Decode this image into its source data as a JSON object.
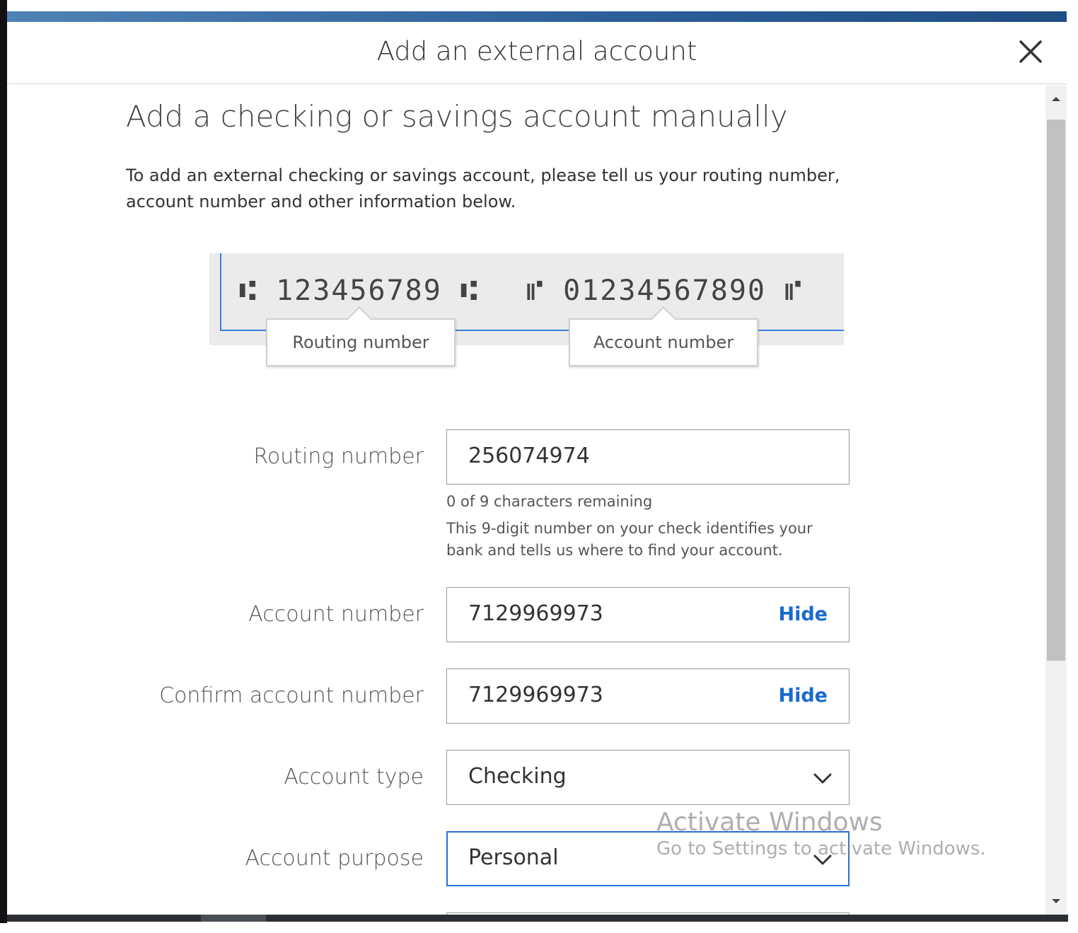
{
  "header": {
    "title": "Add an external account"
  },
  "page": {
    "title": "Add a checking or savings account manually",
    "intro": "To add an external checking or savings account, please tell us your routing number, account number and other information below."
  },
  "check_diagram": {
    "routing_digits": "⑆ 123456789 ⑆",
    "account_digits": "⑈ 01234567890 ⑈",
    "routing_callout": "Routing number",
    "account_callout": "Account number"
  },
  "form": {
    "routing": {
      "label": "Routing number",
      "value": "256074974",
      "counter": "0 of 9 characters remaining",
      "help": "This 9-digit number on your check identifies your bank and tells us where to find your account."
    },
    "account": {
      "label": "Account number",
      "value": "7129969973",
      "toggle": "Hide"
    },
    "confirm": {
      "label": "Confirm account number",
      "value": "7129969973",
      "toggle": "Hide"
    },
    "type": {
      "label": "Account type",
      "value": "Checking"
    },
    "purpose": {
      "label": "Account purpose",
      "value": "Personal"
    }
  },
  "watermark": {
    "line1": "Activate Windows",
    "line2": "Go to Settings to activate Windows."
  },
  "colors": {
    "accent": "#1a6ad0",
    "focus": "#2a6fd6",
    "header_bar": "#2e5f99"
  }
}
